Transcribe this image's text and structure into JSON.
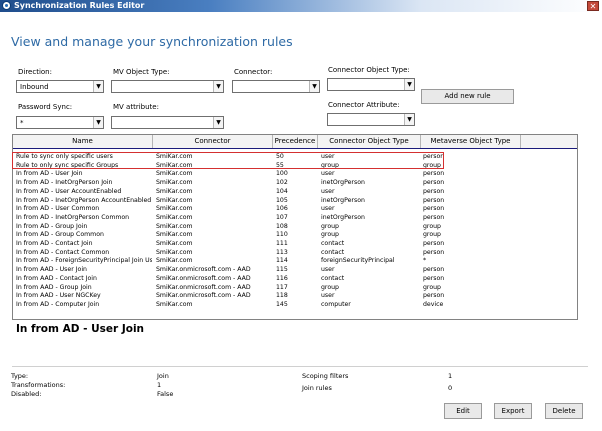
{
  "window": {
    "title": "Synchronization Rules Editor",
    "close": "✕"
  },
  "heading": "View and manage your synchronization rules",
  "filters": {
    "direction": {
      "label": "Direction:",
      "value": "Inbound"
    },
    "mv_object_type": {
      "label": "MV Object Type:",
      "value": ""
    },
    "connector": {
      "label": "Connector:",
      "value": ""
    },
    "connector_object_type": {
      "label": "Connector Object Type:",
      "value": ""
    },
    "password_sync": {
      "label": "Password Sync:",
      "value": "*"
    },
    "mv_attribute": {
      "label": "MV attribute:",
      "value": ""
    },
    "connector_attribute": {
      "label": "Connector Attribute:",
      "value": ""
    }
  },
  "add_rule_label": "Add new rule",
  "grid": {
    "columns": [
      "Name",
      "Connector",
      "Precedence",
      "Connector Object Type",
      "Metaverse Object Type"
    ],
    "rows": [
      [
        "Rule to sync only specific users",
        "SmiKar.com",
        "50",
        "user",
        "person"
      ],
      [
        "Rule to only sync specific Groups",
        "SmiKar.com",
        "55",
        "group",
        "group"
      ],
      [
        "In from AD - User Join",
        "SmiKar.com",
        "100",
        "user",
        "person"
      ],
      [
        "In from AD - InetOrgPerson Join",
        "SmiKar.com",
        "102",
        "inetOrgPerson",
        "person"
      ],
      [
        "In from AD - User AccountEnabled",
        "SmiKar.com",
        "104",
        "user",
        "person"
      ],
      [
        "In from AD - InetOrgPerson AccountEnabled",
        "SmiKar.com",
        "105",
        "inetOrgPerson",
        "person"
      ],
      [
        "In from AD - User Common",
        "SmiKar.com",
        "106",
        "user",
        "person"
      ],
      [
        "In from AD - InetOrgPerson Common",
        "SmiKar.com",
        "107",
        "inetOrgPerson",
        "person"
      ],
      [
        "In from AD - Group Join",
        "SmiKar.com",
        "108",
        "group",
        "group"
      ],
      [
        "In from AD - Group Common",
        "SmiKar.com",
        "110",
        "group",
        "group"
      ],
      [
        "In from AD - Contact Join",
        "SmiKar.com",
        "111",
        "contact",
        "person"
      ],
      [
        "In from AD - Contact Common",
        "SmiKar.com",
        "113",
        "contact",
        "person"
      ],
      [
        "In from AD - ForeignSecurityPrincipal Join Us",
        "SmiKar.com",
        "114",
        "foreignSecurityPrincipal",
        "*"
      ],
      [
        "In from AAD - User Join",
        "SmiKar.onmicrosoft.com - AAD",
        "115",
        "user",
        "person"
      ],
      [
        "In from AAD - Contact Join",
        "SmiKar.onmicrosoft.com - AAD",
        "116",
        "contact",
        "person"
      ],
      [
        "In from AAD - Group Join",
        "SmiKar.onmicrosoft.com - AAD",
        "117",
        "group",
        "group"
      ],
      [
        "In from AAD - User NGCKey",
        "SmiKar.onmicrosoft.com - AAD",
        "118",
        "user",
        "person"
      ],
      [
        "In from AD - Computer Join",
        "SmiKar.com",
        "145",
        "computer",
        "device"
      ]
    ]
  },
  "selected_rule": "In from AD - User Join",
  "details": {
    "type_label": "Type:",
    "type_value": "Join",
    "transformations_label": "Transformations:",
    "transformations_value": "1",
    "disabled_label": "Disabled:",
    "disabled_value": "False",
    "scoping_label": "Scoping filters",
    "scoping_value": "1",
    "join_label": "Join rules",
    "join_value": "0"
  },
  "buttons": {
    "edit": "Edit",
    "export": "Export",
    "delete": "Delete"
  },
  "colors": {
    "heading": "#2e6aa5",
    "highlight_box": "#d43030",
    "title_bar": "#1f4d8c"
  }
}
